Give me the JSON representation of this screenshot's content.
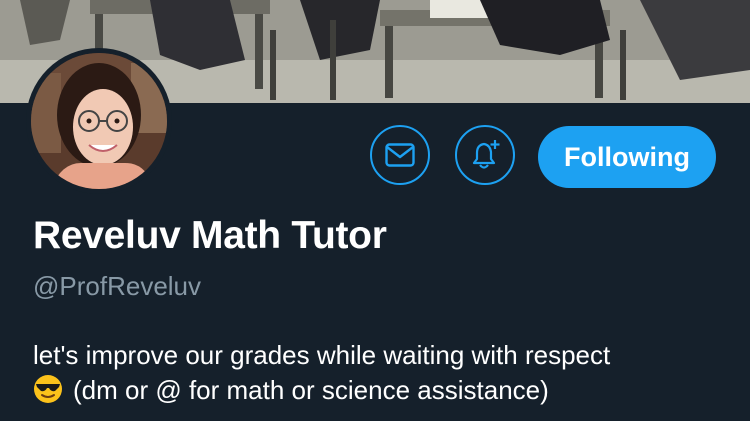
{
  "profile": {
    "display_name": "Reveluv Math Tutor",
    "handle": "@ProfReveluv",
    "bio_line1": "let's improve our grades while waiting with respect",
    "bio_line2": "(dm or @ for math or science assistance)",
    "bio_emoji": "sunglasses-face-emoji"
  },
  "actions": {
    "message_icon": "envelope-icon",
    "notification_icon": "bell-plus-icon",
    "follow_label": "Following"
  },
  "colors": {
    "background": "#15202b",
    "accent": "#1da1f2",
    "secondary_text": "#8899a6",
    "primary_text": "#ffffff"
  }
}
